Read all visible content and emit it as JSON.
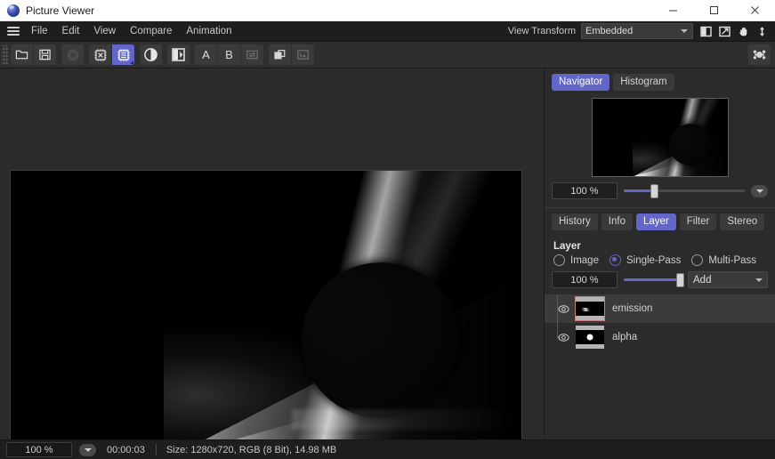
{
  "window": {
    "title": "Picture Viewer",
    "app_icon": "sphere-logo-icon",
    "minimize_label": "",
    "maximize_label": "",
    "close_label": ""
  },
  "menubar": {
    "hamburger": "hamburger-menu-icon",
    "items": [
      {
        "label": "File"
      },
      {
        "label": "Edit"
      },
      {
        "label": "View"
      },
      {
        "label": "Compare"
      },
      {
        "label": "Animation"
      }
    ],
    "view_transform_label": "View Transform",
    "view_transform_value": "Embedded",
    "header_icons": [
      {
        "name": "half-square-icon"
      },
      {
        "name": "open-external-icon"
      },
      {
        "name": "hand-pan-icon"
      },
      {
        "name": "vertical-arrows-icon"
      }
    ]
  },
  "toolbar": {
    "groups": [
      {
        "buttons": [
          {
            "name": "open-folder-icon",
            "state": "normal"
          },
          {
            "name": "save-disk-icon",
            "state": "normal"
          }
        ]
      },
      {
        "buttons": [
          {
            "name": "stop-render-icon",
            "state": "disabled"
          }
        ]
      },
      {
        "buttons": [
          {
            "name": "chip-cpu-icon",
            "state": "normal"
          },
          {
            "name": "chip-gpu-icon",
            "state": "selected"
          }
        ]
      },
      {
        "buttons": [
          {
            "name": "contrast-circle-icon",
            "state": "normal"
          }
        ]
      },
      {
        "buttons": [
          {
            "name": "compare-split-icon",
            "state": "normal"
          }
        ]
      },
      {
        "buttons": [
          {
            "name": "slot-a-icon",
            "state": "normal",
            "label": "A"
          },
          {
            "name": "slot-b-icon",
            "state": "normal",
            "label": "B"
          },
          {
            "name": "swap-ab-icon",
            "state": "disabled"
          }
        ]
      },
      {
        "buttons": [
          {
            "name": "copy-layers-icon",
            "state": "normal"
          },
          {
            "name": "send-to-icon",
            "state": "disabled"
          }
        ]
      }
    ],
    "right_button": {
      "name": "settings-gear-icon"
    }
  },
  "navigator": {
    "tabs": [
      {
        "label": "Navigator",
        "active": true
      },
      {
        "label": "Histogram",
        "active": false
      }
    ],
    "zoom_value": "100 %",
    "zoom_percent": 100,
    "slider_knob_percent": 24,
    "dropdown_icon": "chevron-down-icon"
  },
  "layer_panel": {
    "tabs": [
      {
        "label": "History",
        "active": false
      },
      {
        "label": "Info",
        "active": false
      },
      {
        "label": "Layer",
        "active": true
      },
      {
        "label": "Filter",
        "active": false
      },
      {
        "label": "Stereo",
        "active": false
      }
    ],
    "section_title": "Layer",
    "modes": [
      {
        "label": "Image",
        "selected": false
      },
      {
        "label": "Single-Pass",
        "selected": true
      },
      {
        "label": "Multi-Pass",
        "selected": false
      }
    ],
    "opacity_value": "100 %",
    "opacity_percent": 100,
    "blend_mode": "Add",
    "blend_dropdown_icon": "chevron-down-icon",
    "layers": [
      {
        "name": "emission",
        "visible": true,
        "selected": true,
        "eye_icon": "eye-icon",
        "thumbnail": "emission-thumbnail"
      },
      {
        "name": "alpha",
        "visible": true,
        "selected": false,
        "eye_icon": "eye-icon",
        "thumbnail": "alpha-thumbnail"
      }
    ]
  },
  "statusbar": {
    "zoom_value": "100 %",
    "zoom_dropdown_icon": "chevron-down-icon",
    "time": "00:00:03",
    "info": "Size: 1280x720, RGB (8 Bit), 14.98 MB"
  },
  "colors": {
    "accent": "#6166c8",
    "panel_bg": "#2b2b2b",
    "toolbar_bg": "#2e2e2e",
    "menubar_bg": "#1e1e1e",
    "titlebar_bg": "#ffffff",
    "selected_layer_outline": "#c87c7c"
  },
  "canvas": {
    "image_description": "dark render of a bright light cone with a dark sphere"
  }
}
